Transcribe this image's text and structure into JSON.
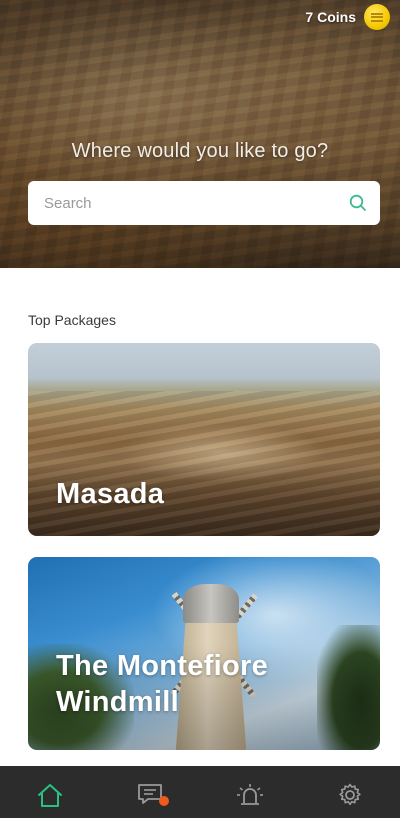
{
  "header": {
    "coins_label": "7 Coins",
    "coin_icon": "coin-icon",
    "question": "Where would you like to go?"
  },
  "search": {
    "placeholder": "Search",
    "icon": "search-icon",
    "icon_color": "#3dbb8f"
  },
  "packages": {
    "section_title": "Top Packages",
    "items": [
      {
        "title": "Masada"
      },
      {
        "title": "The Montefiore Windmill"
      }
    ]
  },
  "bottom_nav": {
    "items": [
      {
        "icon": "home-icon",
        "active": true,
        "color": "#27c281"
      },
      {
        "icon": "messages-icon",
        "badge": true,
        "badge_color": "#f05a1a"
      },
      {
        "icon": "alarm-icon"
      },
      {
        "icon": "gear-icon"
      }
    ]
  },
  "colors": {
    "accent": "#27c281",
    "nav_background": "#2c2c2c",
    "coin": "#f5c800"
  }
}
